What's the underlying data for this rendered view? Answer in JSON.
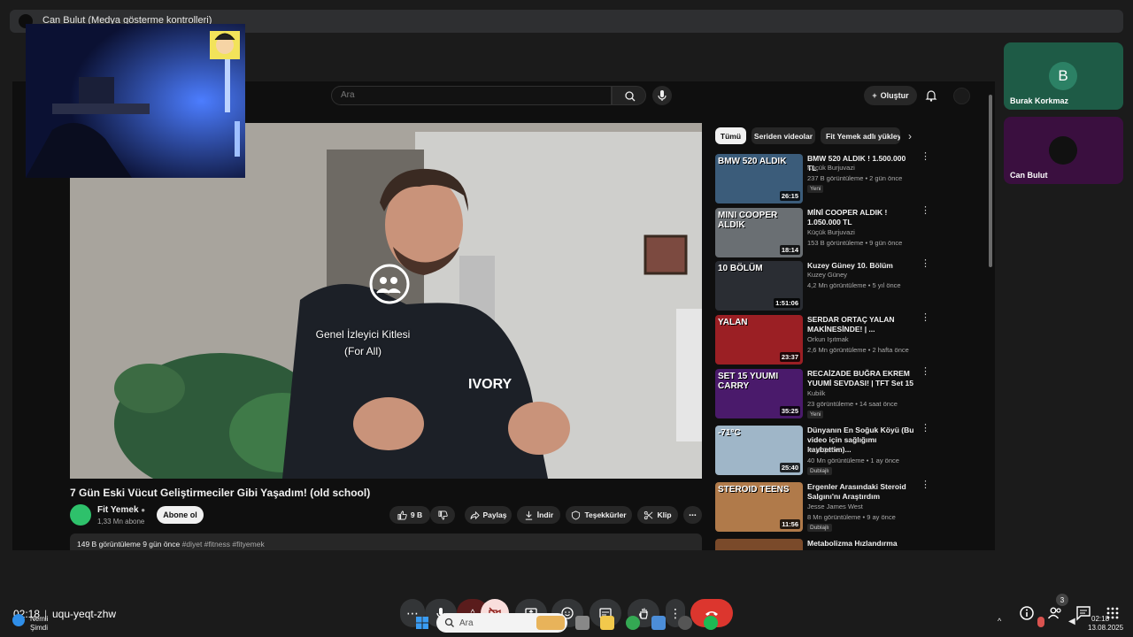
{
  "presenter_bar": {
    "label": "Can Bulut (Medya gösterme kontrolleri)"
  },
  "youtube": {
    "search_placeholder": "Ara",
    "create_label": "Oluştur",
    "video": {
      "overlay_line1": "Genel İzleyici Kitlesi",
      "overlay_line2": "(For All)",
      "title": "7 Gün Eski Vücut Geliştirmeciler Gibi Yaşadım! (old school)",
      "channel": "Fit Yemek",
      "subscribers": "1,33 Mn abone",
      "subscribe_label": "Abone ol",
      "likes": "9 B",
      "share_label": "Paylaş",
      "download_label": "İndir",
      "thanks_label": "Teşekkürler",
      "clip_label": "Klip",
      "stats": "149 B görüntüleme  9 gün önce",
      "tags": "#diyet #fitness #fityemek"
    },
    "chips": [
      "Tümü",
      "Seriden videolar",
      "Fit Yemek adlı yükleyiciden"
    ],
    "recommendations": [
      {
        "title": "BMW 520 ALDIK ! 1.500.000 TL",
        "channel": "Küçük Burjuvazi",
        "meta": "237 B görüntüleme • 2 gün önce",
        "badge": "Yeni",
        "duration": "26:15",
        "thumb_text": "BMW 520 ALDIK",
        "thumb_color": "#3b5c7a"
      },
      {
        "title": "MİNİ COOPER ALDIK ! 1.050.000 TL",
        "channel": "Küçük Burjuvazi",
        "meta": "153 B görüntüleme • 9 gün önce",
        "badge": "",
        "duration": "18:14",
        "thumb_text": "MINI COOPER ALDIK",
        "thumb_color": "#6a6f73"
      },
      {
        "title": "Kuzey Güney 10. Bölüm",
        "channel": "Kuzey Güney",
        "meta": "4,2 Mn görüntüleme • 5 yıl önce",
        "badge": "",
        "duration": "1:51:06",
        "thumb_text": "10 BÖLÜM",
        "thumb_color": "#2a2d33"
      },
      {
        "title": "SERDAR ORTAÇ YALAN MAKİNESİNDE! | ...",
        "channel": "Orkun Işıtmak",
        "meta": "2,6 Mn görüntüleme • 2 hafta önce",
        "badge": "",
        "duration": "23:37",
        "thumb_text": "YALAN",
        "thumb_color": "#9b1f24"
      },
      {
        "title": "RECAİZADE BUĞRA EKREM YUUMİ SEVDASI! | TFT Set 15",
        "channel": "Kubilk",
        "meta": "23 görüntüleme • 14 saat önce",
        "badge": "Yeni",
        "duration": "35:25",
        "thumb_text": "SET 15 YUUMI CARRY",
        "thumb_color": "#4a1a6b"
      },
      {
        "title": "Dünyanın En Soğuk Köyü (Bu video için sağlığımı kaybettim)...",
        "channel": "Ruhi Çenet",
        "meta": "40 Mn görüntüleme • 1 ay önce",
        "badge": "Dublajlı",
        "duration": "25:40",
        "thumb_text": "-71°C",
        "thumb_color": "#9fb6c8"
      },
      {
        "title": "Ergenler Arasındaki Steroid Salgını'nı Araştırdım",
        "channel": "Jesse James West",
        "meta": "8 Mn görüntüleme • 9 ay önce",
        "badge": "Dublajlı",
        "duration": "11:56",
        "thumb_text": "STEROID TEENS",
        "thumb_color": "#b07a4a"
      },
      {
        "title": "Metabolizma Hızlandırma",
        "channel": "",
        "meta": "",
        "badge": "",
        "duration": "",
        "thumb_text": "",
        "thumb_color": "#7a4a2a"
      }
    ]
  },
  "participants": [
    {
      "name": "Burak Korkmaz",
      "initial": "B"
    },
    {
      "name": "Can Bulut",
      "initial": ""
    }
  ],
  "meeting": {
    "time": "02:18",
    "code": "uqu-yeqt-zhw",
    "people_count": "3"
  },
  "taskbar": {
    "search_placeholder": "Ara",
    "weather_line1": "Nemli",
    "weather_line2": "Şimdi",
    "clock_time": "02:18",
    "clock_date": "13.08.2025"
  },
  "colors": {
    "end_call": "#dc362e",
    "youtube_bg": "#0f0f0f",
    "burak_tile": "#1e5b46",
    "can_tile": "#3a0f3f"
  }
}
